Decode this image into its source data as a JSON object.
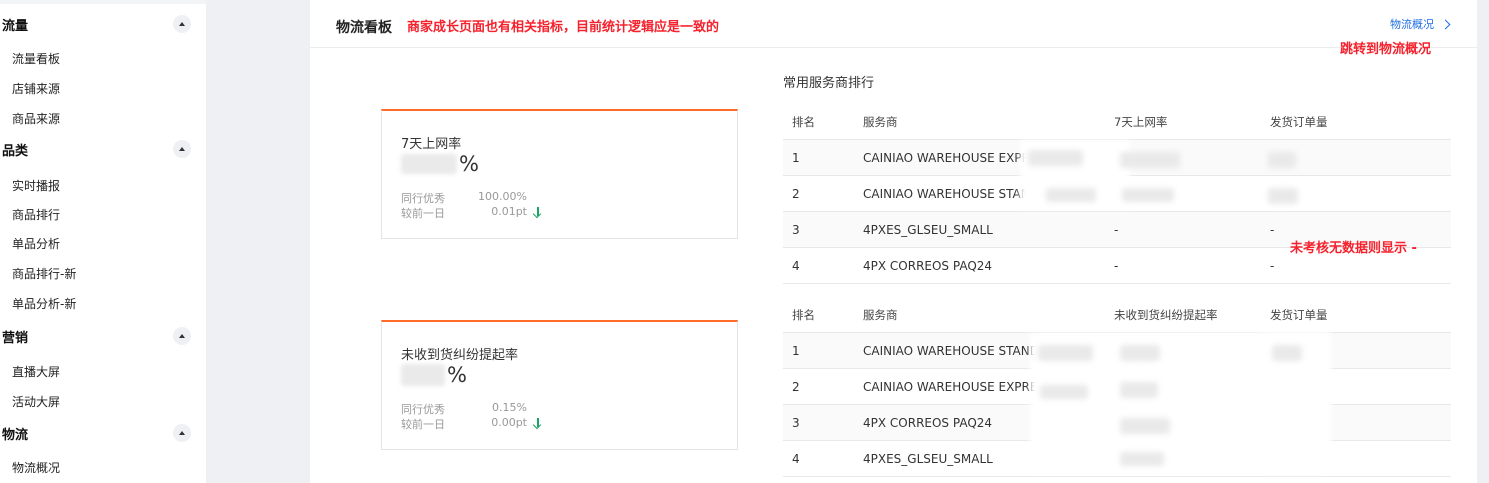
{
  "sidebar": {
    "groups": [
      {
        "title": "流量",
        "items": [
          "流量看板",
          "店铺来源",
          "商品来源"
        ]
      },
      {
        "title": "品类",
        "items": [
          "实时播报",
          "商品排行",
          "单品分析",
          "商品排行-新",
          "单品分析-新"
        ]
      },
      {
        "title": "营销",
        "items": [
          "直播大屏",
          "活动大屏"
        ]
      },
      {
        "title": "物流",
        "items": [
          "物流概况"
        ]
      }
    ]
  },
  "header": {
    "title": "物流看板",
    "note": "商家成长页面也有相关指标，目前统计逻辑应是一致的",
    "link_label": "物流概况",
    "link_note": "跳转到物流概况"
  },
  "cards": [
    {
      "label": "7天上网率",
      "unit": "%",
      "peer_label": "同行优秀",
      "peer_value": "100.00%",
      "delta_label": "较前一日",
      "delta_value": "0.01pt",
      "trend_icon": "arrow-down-icon"
    },
    {
      "label": "未收到货纠纷提起率",
      "unit": "%",
      "peer_label": "同行优秀",
      "peer_value": "0.15%",
      "delta_label": "较前一日",
      "delta_value": "0.00pt",
      "trend_icon": "arrow-down-icon"
    }
  ],
  "ranking": {
    "title": "常用服务商排行",
    "table1": {
      "headers": [
        "排名",
        "服务商",
        "7天上网率",
        "发货订单量"
      ],
      "rows": [
        {
          "rank": "1",
          "provider": "CAINIAO WAREHOUSE EXPRESS",
          "rate": "",
          "volume": ""
        },
        {
          "rank": "2",
          "provider": "CAINIAO WAREHOUSE STANDARD",
          "rate": "",
          "volume": ""
        },
        {
          "rank": "3",
          "provider": "4PXES_GLSEU_SMALL",
          "rate": "-",
          "volume": "-"
        },
        {
          "rank": "4",
          "provider": "4PX CORREOS PAQ24",
          "rate": "-",
          "volume": "-"
        }
      ],
      "note": "未考核无数据则显示 -"
    },
    "table2": {
      "headers": [
        "排名",
        "服务商",
        "未收到货纠纷提起率",
        "发货订单量"
      ],
      "rows": [
        {
          "rank": "1",
          "provider": "CAINIAO WAREHOUSE STANDARD",
          "rate": "",
          "volume": ""
        },
        {
          "rank": "2",
          "provider": "CAINIAO WAREHOUSE EXPRESS",
          "rate": "",
          "volume": ""
        },
        {
          "rank": "3",
          "provider": "4PX CORREOS PAQ24",
          "rate": "",
          "volume": ""
        },
        {
          "rank": "4",
          "provider": "4PXES_GLSEU_SMALL",
          "rate": "",
          "volume": ""
        }
      ]
    }
  },
  "colors": {
    "accent": "#ff6a2a",
    "link": "#1f6fe5",
    "note": "#f5222d",
    "down": "#1aa362"
  }
}
